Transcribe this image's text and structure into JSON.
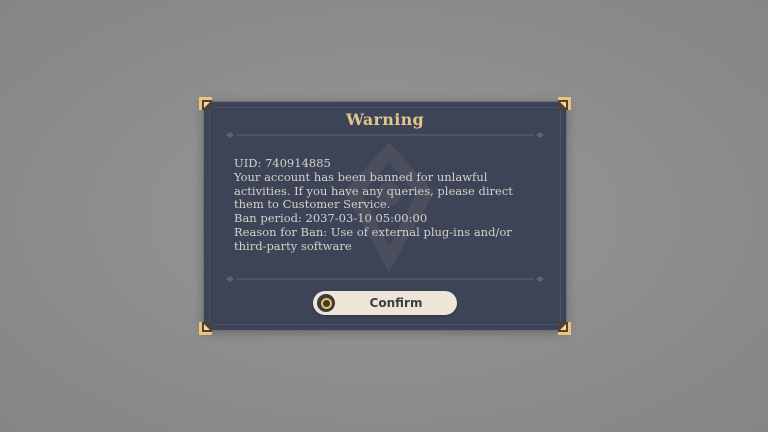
{
  "dialog": {
    "title": "Warning",
    "message_lines": [
      "UID: 740914885",
      "Your account has been banned for unlawful",
      "activities. If you have any queries, please direct",
      "them to Customer Service.",
      "Ban period: 2037-03-10 05:00:00",
      "Reason for Ban: Use of external plug-ins and/or",
      "third-party software"
    ],
    "confirm_button": {
      "label": "Confirm",
      "icon": "circle-o-icon"
    }
  },
  "colors": {
    "backdrop": "#8e8e8e",
    "dialog_bg": "#3e4457",
    "title": "#e3c58b",
    "body_text": "#d4d1ca",
    "button_bg": "#ece5d8",
    "button_text": "#3b3d45",
    "corner_accent": "#f0c27a"
  }
}
